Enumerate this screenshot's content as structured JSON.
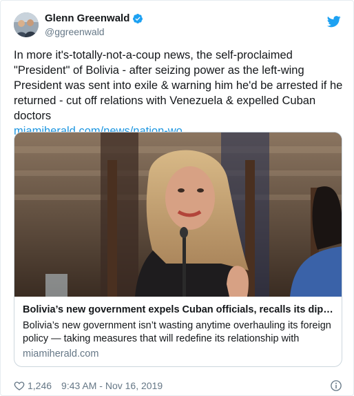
{
  "author": {
    "name": "Glenn Greenwald",
    "handle": "@ggreenwald"
  },
  "tweet": {
    "text": "In more it's-totally-not-a-coup news, the self-proclaimed \"President\" of Bolivia - after seizing power as the left-wing President was sent into exile & warning him he'd be arrested if he returned - cut off relations with Venezuela & expelled Cuban doctors",
    "link_text": "miamiherald.com/news/nation-wo…"
  },
  "card": {
    "title": "Bolivia’s new government expels Cuban officials, recalls its diplo…",
    "description": "Bolivia’s new government isn’t wasting anytime overhauling its foreign policy — taking measures that will redefine its relationship with longtime",
    "domain": "miamiherald.com"
  },
  "footer": {
    "likes": "1,246",
    "timestamp": "9:43 AM - Nov 16, 2019"
  },
  "icons": {
    "verified": "verified-badge-icon",
    "twitter": "twitter-bird-icon",
    "heart": "heart-icon",
    "info": "info-icon"
  },
  "colors": {
    "link": "#1b95e0",
    "verified": "#1da1f2",
    "secondary_text": "#657786"
  }
}
